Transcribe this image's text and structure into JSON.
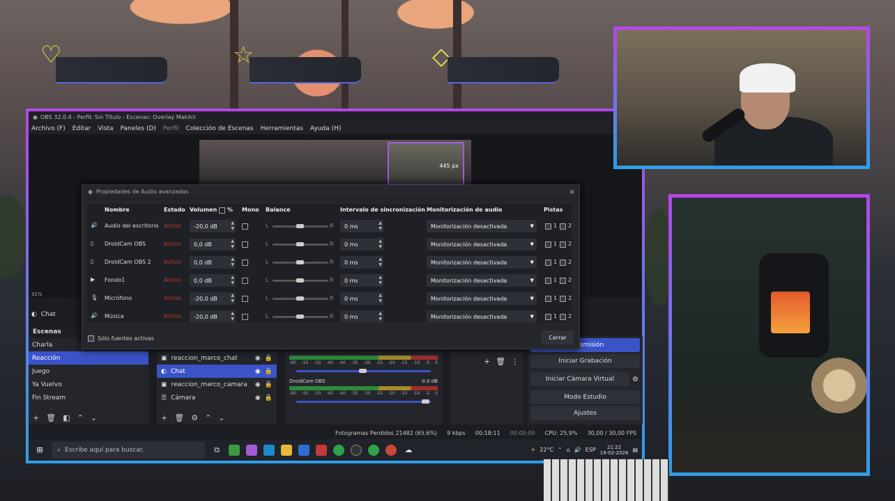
{
  "obs": {
    "title": "OBS 32.0.4 - Perfil: Sin Título - Escenas: Overlay Makikii",
    "menu": [
      "Archivo (F)",
      "Editar",
      "Vista",
      "Paneles (D)",
      "Perfil",
      "Colección de Escenas",
      "Herramientas",
      "Ayuda (H)"
    ],
    "preview_overlay_text": "445 px",
    "zoom": "31%"
  },
  "dialog": {
    "title": "Propiedades de Audio avanzadas",
    "headers": {
      "name": "Nombre",
      "status": "Estado",
      "volume": "Volumen",
      "percent": "%",
      "mono": "Mono",
      "balance": "Balance",
      "sync": "Intervalo de sincronización",
      "monitoring": "Monitorización de audio",
      "tracks": "Pistas"
    },
    "rows": [
      {
        "name": "Audio del escritorio",
        "status": "Activo",
        "volume": "-20,0 dB",
        "sync": "0 ms",
        "monitoring": "Monitorización desactivada"
      },
      {
        "name": "DroidCam OBS",
        "status": "Activo",
        "volume": "0,0 dB",
        "sync": "0 ms",
        "monitoring": "Monitorización desactivada"
      },
      {
        "name": "DroidCam OBS 2",
        "status": "Activo",
        "volume": "0,0 dB",
        "sync": "0 ms",
        "monitoring": "Monitorización desactivada"
      },
      {
        "name": "Fondo1",
        "status": "Activo",
        "volume": "0,0 dB",
        "sync": "0 ms",
        "monitoring": "Monitorización desactivada"
      },
      {
        "name": "Micrófono",
        "status": "Activo",
        "volume": "-20,0 dB",
        "sync": "0 ms",
        "monitoring": "Monitorización desactivada"
      },
      {
        "name": "Música",
        "status": "Activo",
        "volume": "-20,0 dB",
        "sync": "0 ms",
        "monitoring": "Monitorización desactivada"
      }
    ],
    "balance_left": "L",
    "balance_right": "R",
    "track1": "1",
    "track2": "2",
    "only_active_label": "Sólo fuentes activas",
    "close_button": "Cerrar"
  },
  "chat_dock_label": "Chat",
  "scenes": {
    "title": "Escenas",
    "items": [
      "Charla",
      "Reacción",
      "Juego",
      "Ya Vuelvo",
      "Fin Stream"
    ],
    "selected_index": 1
  },
  "sources": {
    "items": [
      "reaccion_marco_chat",
      "Chat",
      "reaccion_marco_camara",
      "Cámara"
    ],
    "selected_index": 1
  },
  "mixer": {
    "channel": "DroidCam OBS",
    "db": "0.0 dB",
    "ticks": [
      "-60",
      "-55",
      "-50",
      "-45",
      "-40",
      "-35",
      "-30",
      "-25",
      "-20",
      "-15",
      "-10",
      "-5",
      "0"
    ]
  },
  "controls": {
    "buttons": [
      "Transmisión",
      "Iniciar Grabación",
      "Iniciar Cámara Virtual",
      "Modo Estudio",
      "Ajustes"
    ]
  },
  "status_bar": {
    "dropped": "Fotogramas Perdidos 21482 (65,6%)",
    "bitrate": "9 kbps",
    "stream_time": "00:18:11",
    "rec_time": "00:00:00",
    "cpu": "CPU: 25,9%",
    "fps": "30,00 / 30,00 FPS"
  },
  "taskbar": {
    "search_placeholder": "Escribe aquí para buscar.",
    "temperature": "22°C",
    "lang": "ESP",
    "time": "21:22",
    "date": "19-02-2026"
  },
  "colors": {
    "accent": "#3a54c8",
    "frame_top": "#b547e8",
    "frame_bottom": "#2f9ee8",
    "status_active": "#c0392b"
  }
}
